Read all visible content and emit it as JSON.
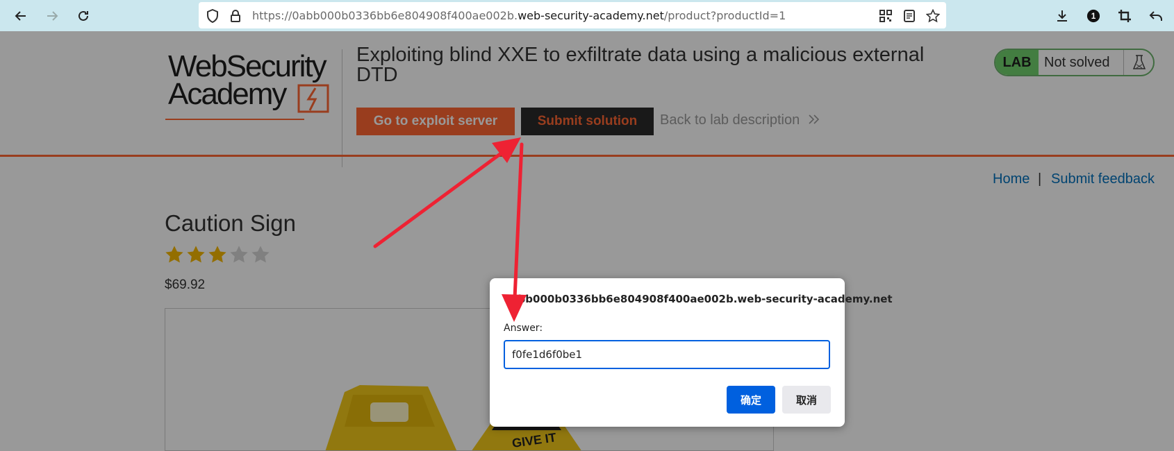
{
  "browser": {
    "url_prefix": "https://0abb000b0336bb6e804908f400ae002b.",
    "url_domain": "web-security-academy.net",
    "url_path": "/product?productId=1",
    "badge_count": "1"
  },
  "header": {
    "logo_line1": "WebSecurity",
    "logo_line2": "Academy",
    "lab_title": "Exploiting blind XXE to exfiltrate data using a malicious external DTD",
    "exploit_button": "Go to exploit server",
    "submit_button": "Submit solution",
    "back_link": "Back to lab description",
    "status_tag": "LAB",
    "status_text": "Not solved"
  },
  "nav": {
    "home": "Home",
    "separator": "|",
    "feedback": "Submit feedback"
  },
  "product": {
    "name": "Caution Sign",
    "rating": 3,
    "rating_max": 5,
    "price": "$69.92",
    "image_caption": "GIVE IT"
  },
  "dialog": {
    "origin": "0abb000b0336bb6e804908f400ae002b.web-security-academy.net",
    "label": "Answer:",
    "input_value": "f0fe1d6f0be1",
    "ok_label": "确定",
    "cancel_label": "取消"
  },
  "colors": {
    "accent": "#ff6633",
    "dark": "#2b2b2b",
    "link": "#0071bc",
    "primary_button": "#0060df",
    "annotation_arrow": "#ee2233"
  }
}
